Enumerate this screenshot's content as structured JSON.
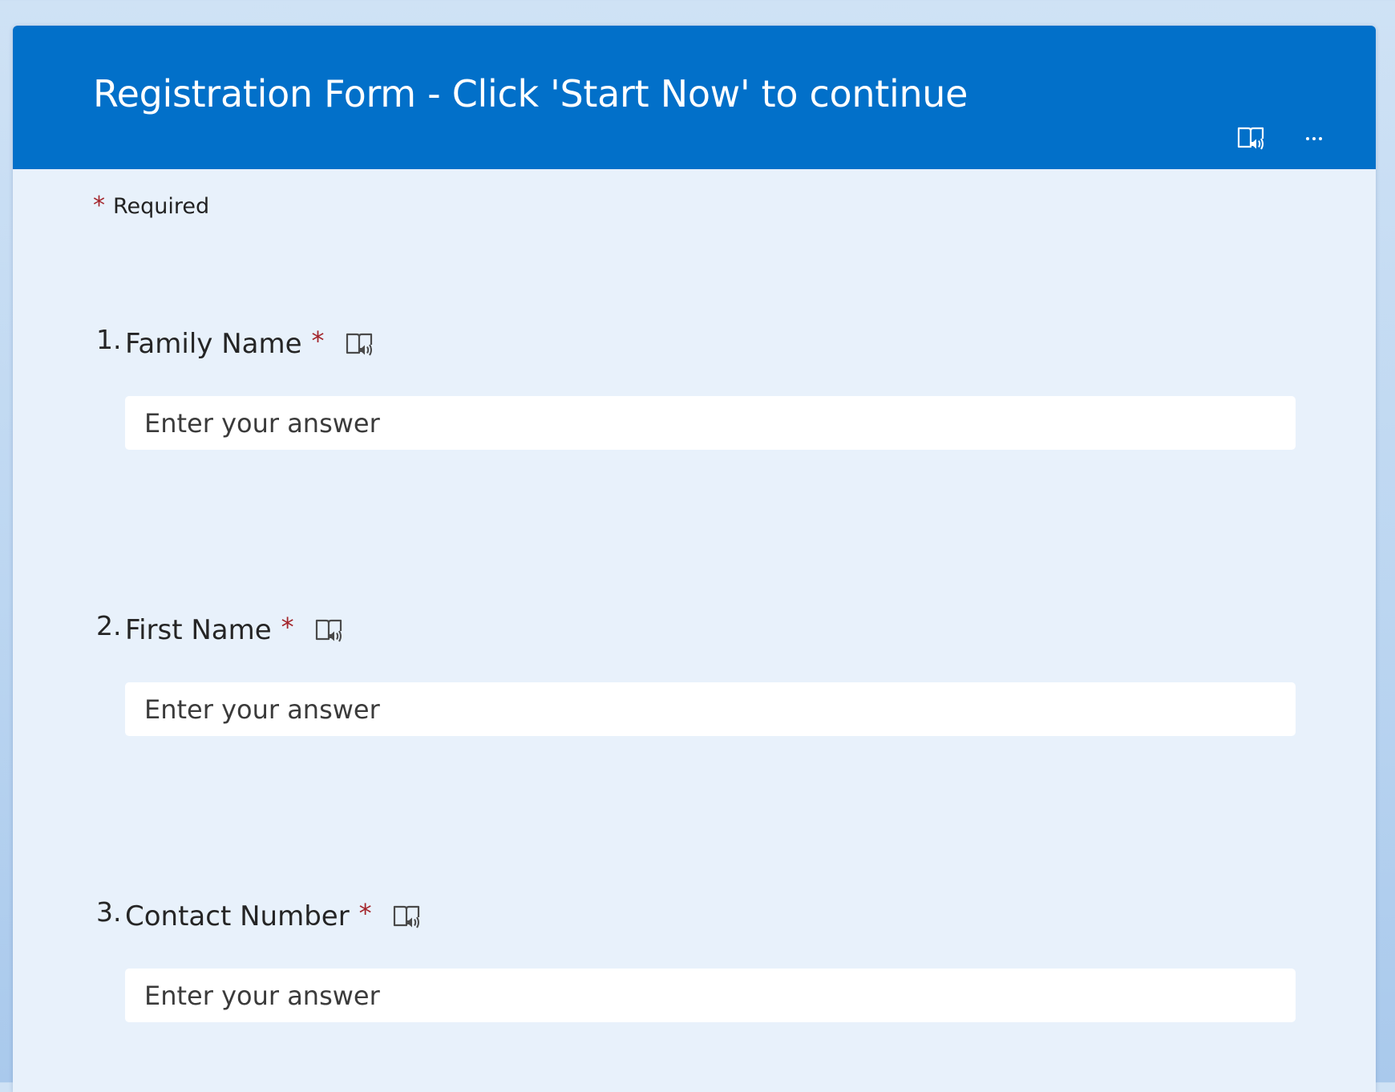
{
  "form": {
    "title": "Registration Form - Click 'Start Now' to continue",
    "required_star": "*",
    "required_label": "Required"
  },
  "header_icons": {
    "reader": "immersive-reader-icon",
    "more": "more-options-icon"
  },
  "questions": [
    {
      "number": "1.",
      "label": "Family Name",
      "required_star": "*",
      "placeholder": "Enter your answer",
      "value": ""
    },
    {
      "number": "2.",
      "label": "First Name",
      "required_star": "*",
      "placeholder": "Enter your answer",
      "value": ""
    },
    {
      "number": "3.",
      "label": "Contact Number",
      "required_star": "*",
      "placeholder": "Enter your answer",
      "value": ""
    }
  ],
  "colors": {
    "header": "#0270c9",
    "card_background": "#e8f1fb",
    "required_star": "#a4262c",
    "page_background": "#c4dbf3"
  }
}
